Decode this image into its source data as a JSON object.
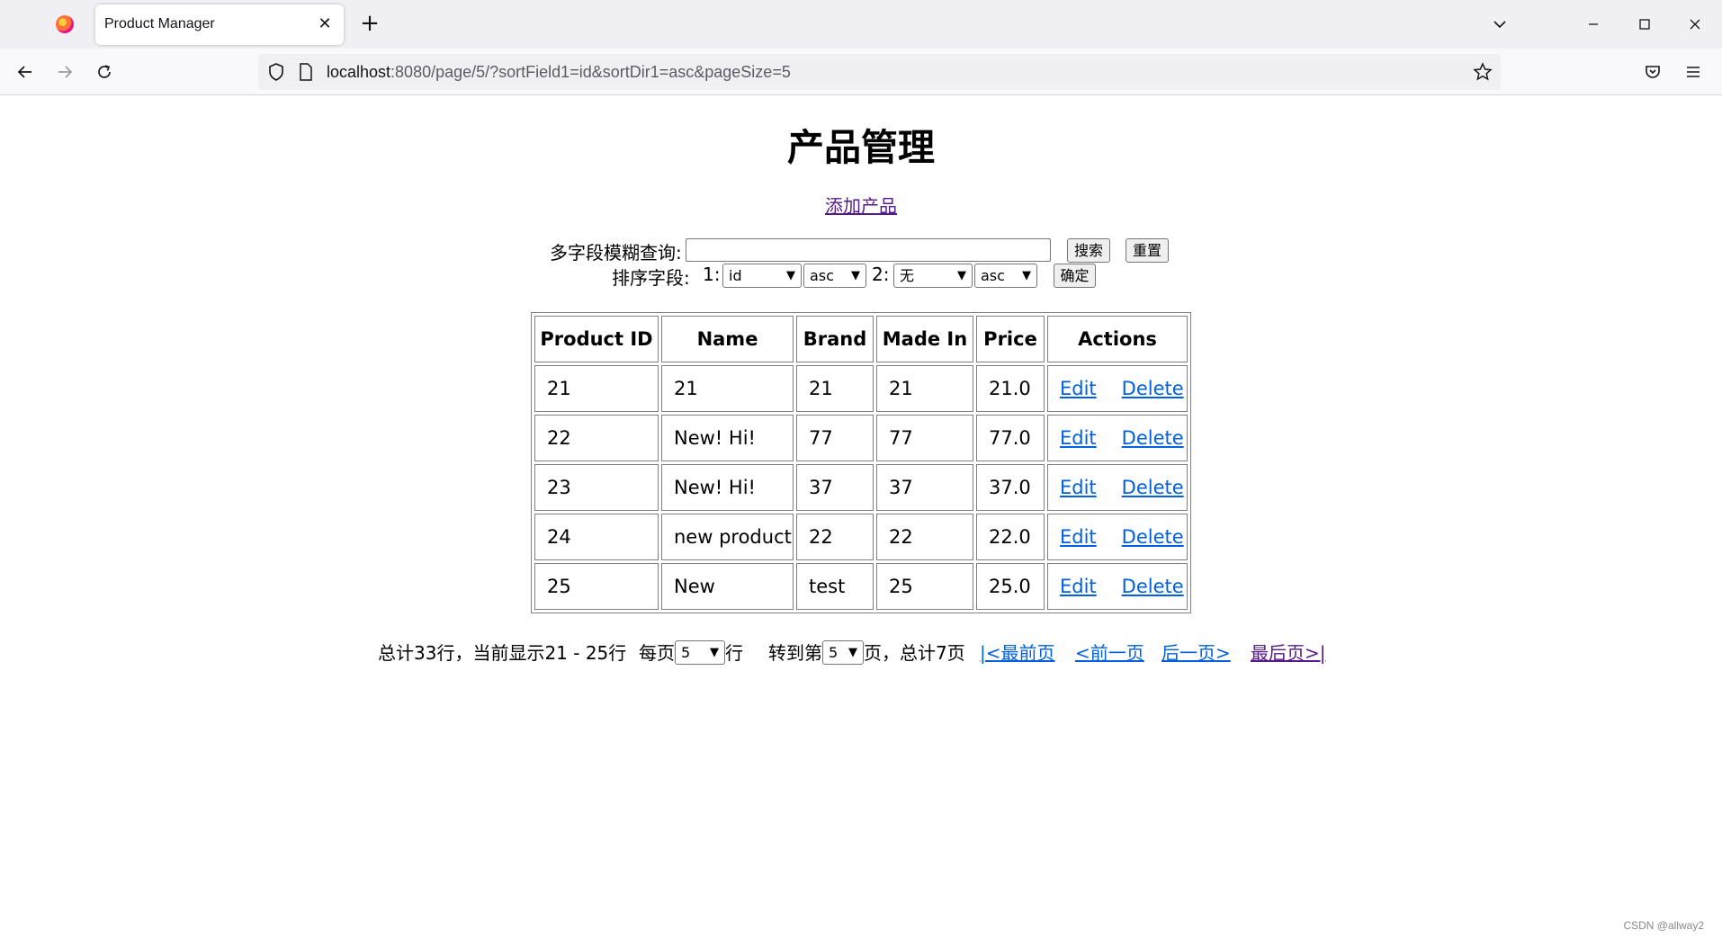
{
  "browser": {
    "tab_title": "Product Manager",
    "tab_close": "✕",
    "new_tab": "+",
    "url_host": "localhost",
    "url_rest": ":8080/page/5/?sortField1=id&sortDir1=asc&pageSize=5"
  },
  "page": {
    "title": "产品管理",
    "add_link": "添加产品"
  },
  "search": {
    "label": "多字段模糊查询:",
    "value": "",
    "search_button": "搜索",
    "reset_button": "重置"
  },
  "sort": {
    "label": "排序字段:",
    "field1_label": "1:",
    "field1_value": "id",
    "dir1_value": "asc",
    "field2_label": "2:",
    "field2_value": "无",
    "dir2_value": "asc",
    "confirm_button": "确定"
  },
  "table": {
    "headers": [
      "Product ID",
      "Name",
      "Brand",
      "Made In",
      "Price",
      "Actions"
    ],
    "edit_label": "Edit",
    "delete_label": "Delete",
    "rows": [
      [
        "21",
        "21",
        "21",
        "21",
        "21.0"
      ],
      [
        "22",
        "New! Hi!",
        "77",
        "77",
        "77.0"
      ],
      [
        "23",
        "New! Hi!",
        "37",
        "37",
        "37.0"
      ],
      [
        "24",
        "new product",
        "22",
        "22",
        "22.0"
      ],
      [
        "25",
        "New",
        "test",
        "25",
        "25.0"
      ]
    ]
  },
  "pagination": {
    "summary": "总计33行，当前显示21 - 25行",
    "per_page_label": "每页",
    "per_page_value": "5",
    "per_page_suffix": "行",
    "goto_label": "转到第",
    "goto_value": "5",
    "goto_suffix": "页，总计7页",
    "first": "|<最前页",
    "prev": "<前一页",
    "next": "后一页>",
    "last": "最后页>|"
  },
  "watermark": "CSDN @allway2",
  "colors": {
    "link": "#0060df",
    "visited_link": "#551a8b"
  },
  "icons": [
    "firefox-logo",
    "back-icon",
    "forward-icon",
    "reload-icon",
    "shield-icon",
    "page-icon",
    "bookmark-star-icon",
    "pocket-icon",
    "menu-icon",
    "chevron-down-icon"
  ]
}
